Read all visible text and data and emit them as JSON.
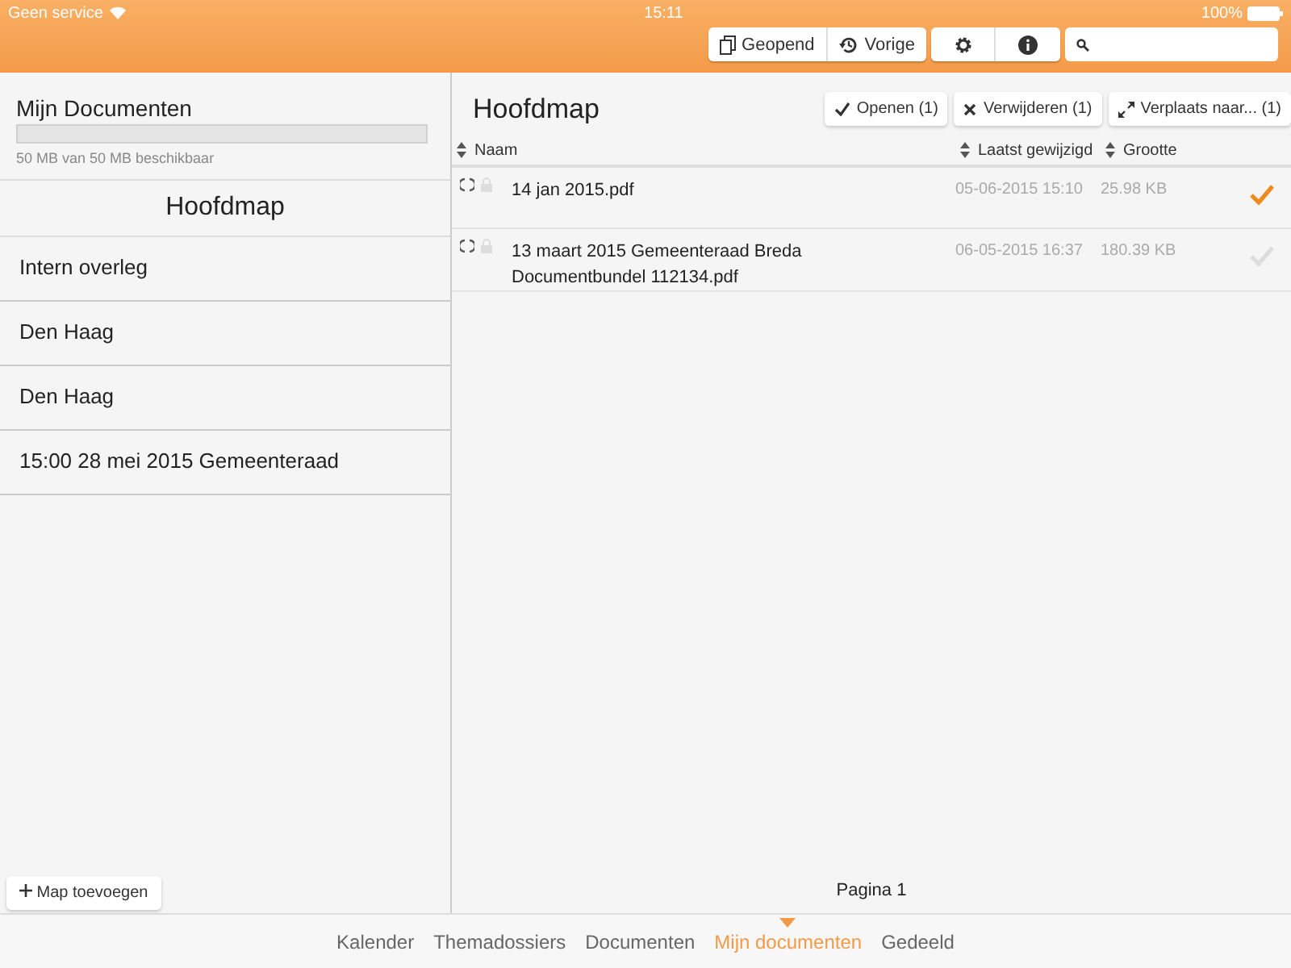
{
  "status_bar": {
    "carrier": "Geen service",
    "time": "15:11",
    "battery": "100%"
  },
  "toolbar": {
    "buttons": [
      {
        "kind": "opened",
        "label": "Geopend"
      },
      {
        "kind": "history",
        "label": "Vorige"
      }
    ],
    "icon_buttons": [
      {
        "kind": "settings"
      },
      {
        "kind": "info"
      }
    ]
  },
  "sidebar": {
    "title": "Mijn Documenten",
    "storage": {
      "reading": "50 MB van 50 MB beschikbaar"
    },
    "folder_header": "Hoofdmap",
    "items": [
      {
        "label": "Intern overleg"
      },
      {
        "label": "Den Haag"
      },
      {
        "label": "Den Haag"
      },
      {
        "label": "15:00 28 mei 2015 Gemeenteraad"
      }
    ],
    "add_button": "Map toevoegen"
  },
  "main": {
    "title": "Hoofdmap",
    "actions": [
      {
        "kind": "open",
        "label": "Openen (1)"
      },
      {
        "kind": "delete",
        "label": "Verwijderen (1)"
      },
      {
        "kind": "move",
        "label": "Verplaats naar... (1)"
      }
    ],
    "columns": [
      "Naam",
      "Laatst gewijzigd",
      "Grootte"
    ],
    "rows": [
      {
        "name": "14 jan 2015.pdf",
        "modified": "05-06-2015 15:10",
        "size": "25.98 KB",
        "checked": true
      },
      {
        "name": "13 maart 2015 Gemeenteraad Breda Documentbundel 112134.pdf",
        "modified": "06-05-2015 16:37",
        "size": "180.39 KB",
        "checked": false
      }
    ],
    "pagination": "Pagina 1"
  },
  "tabs": [
    {
      "label": "Kalender",
      "selected": false
    },
    {
      "label": "Themadossiers",
      "selected": false
    },
    {
      "label": "Documenten",
      "selected": false
    },
    {
      "label": "Mijn documenten",
      "selected": true
    },
    {
      "label": "Gedeeld",
      "selected": false
    }
  ]
}
